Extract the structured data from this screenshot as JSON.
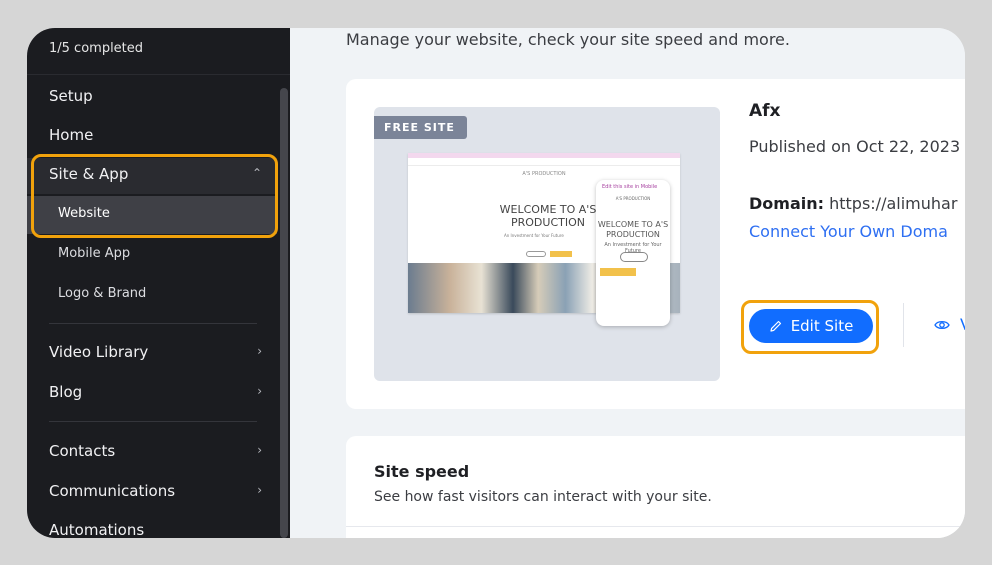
{
  "sidebar": {
    "progress": "1/5 completed",
    "items": {
      "setup": "Setup",
      "home": "Home",
      "site_app": "Site & App",
      "website": "Website",
      "mobile_app": "Mobile App",
      "logo_brand": "Logo & Brand",
      "video_library": "Video Library",
      "blog": "Blog",
      "contacts": "Contacts",
      "communications": "Communications",
      "automations": "Automations"
    },
    "icons": {
      "expanded": "chevron-up-icon",
      "collapsed": "chevron-right-icon"
    }
  },
  "main": {
    "subtitle": "Manage your website, check your site speed and more.",
    "site_card": {
      "badge": "FREE SITE",
      "preview": {
        "desktop_welcome": "WELCOME TO A'S PRODUCTION",
        "phone_bar": "Edit this site in Mobile",
        "phone_welcome": "WELCOME TO A'S PRODUCTION",
        "phone_sub": "An Investment for Your Future"
      },
      "site_name": "Afx",
      "published": "Published on Oct 22, 2023",
      "domain_label": "Domain:",
      "domain_value": "https://alimuhar",
      "connect_domain": "Connect Your Own Doma",
      "edit_button": "Edit Site",
      "view_button": "V"
    },
    "speed_card": {
      "title": "Site speed",
      "description": "See how fast visitors can interact with your site."
    }
  },
  "colors": {
    "accent": "#116dff",
    "highlight": "#f1a20c",
    "sidebar_bg": "#1b1c20"
  }
}
